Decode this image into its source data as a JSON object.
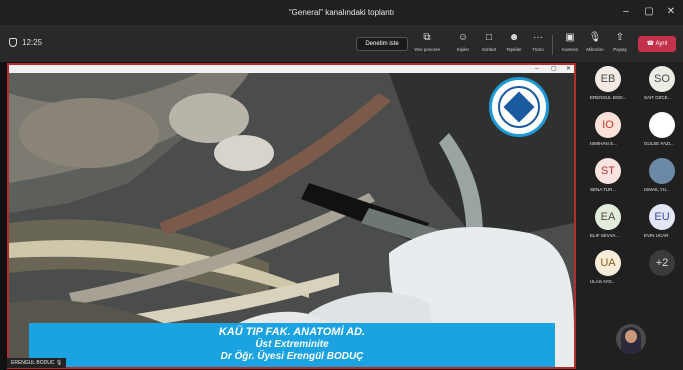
{
  "window": {
    "title": "\"General\" kanalındaki toplantı"
  },
  "toolbar": {
    "timer": "12:25",
    "control_label": "Denetim iste",
    "items": [
      {
        "label": "Yeni pencere",
        "icon": "new-window-icon"
      },
      {
        "label": "Kişiler",
        "icon": "people-icon"
      },
      {
        "label": "Sohbet",
        "icon": "chat-icon"
      },
      {
        "label": "Tepkiler",
        "icon": "reactions-icon"
      },
      {
        "label": "Tümü",
        "icon": "more-icon"
      },
      {
        "label": "Kamera",
        "icon": "camera-icon"
      },
      {
        "label": "Mikrofon",
        "icon": "microphone-icon"
      },
      {
        "label": "Paylaş",
        "icon": "share-icon"
      }
    ],
    "leave_label": "Ayrıl"
  },
  "video": {
    "caption_line1": "KAÜ TIP FAK. ANATOMİ AD.",
    "caption_line2": "Üst Extreminite",
    "caption_line3": "Dr Öğr. Üyesi Erengül BODUÇ",
    "presenter_name": "ERENGUL BODUC"
  },
  "participants": [
    {
      "initials": "EB",
      "name": "ERENGUL BOD...",
      "bg": "#f1ebe4",
      "fg": "#4a4a4a"
    },
    {
      "initials": "SO",
      "name": "SAIT OZCE...",
      "bg": "#e9ede3",
      "fg": "#4a4a4a"
    },
    {
      "initials": "IO",
      "name": "ISMIHAN S...",
      "bg": "#fbe3dc",
      "fg": "#c23b22"
    },
    {
      "initials": "",
      "name": "GULSE FAZI...",
      "bg": "#ffffff",
      "fg": "#4a4a4a"
    },
    {
      "initials": "ST",
      "name": "SENA TUR...",
      "bg": "#fbe3e0",
      "fg": "#b23a3a"
    },
    {
      "initials": "",
      "name": "ISMAIL YU...",
      "bg": "#6c8aa8",
      "fg": "#ffffff"
    },
    {
      "initials": "EA",
      "name": "ELIF SEVVA...",
      "bg": "#e3ecd9",
      "fg": "#4a4a4a"
    },
    {
      "initials": "EU",
      "name": "EVIN UCAR",
      "bg": "#e2e6f5",
      "fg": "#3d4aa0"
    },
    {
      "initials": "UA",
      "name": "ULAS AYD...",
      "bg": "#f7ecd8",
      "fg": "#8a5a1a"
    },
    {
      "initials": "+2",
      "name": "",
      "bg": "#3b3b3b",
      "fg": "#dddddd"
    }
  ],
  "colors": {
    "leave": "#c4314b",
    "caption_bg": "#1aa3e0",
    "share_border": "#b0302e"
  }
}
